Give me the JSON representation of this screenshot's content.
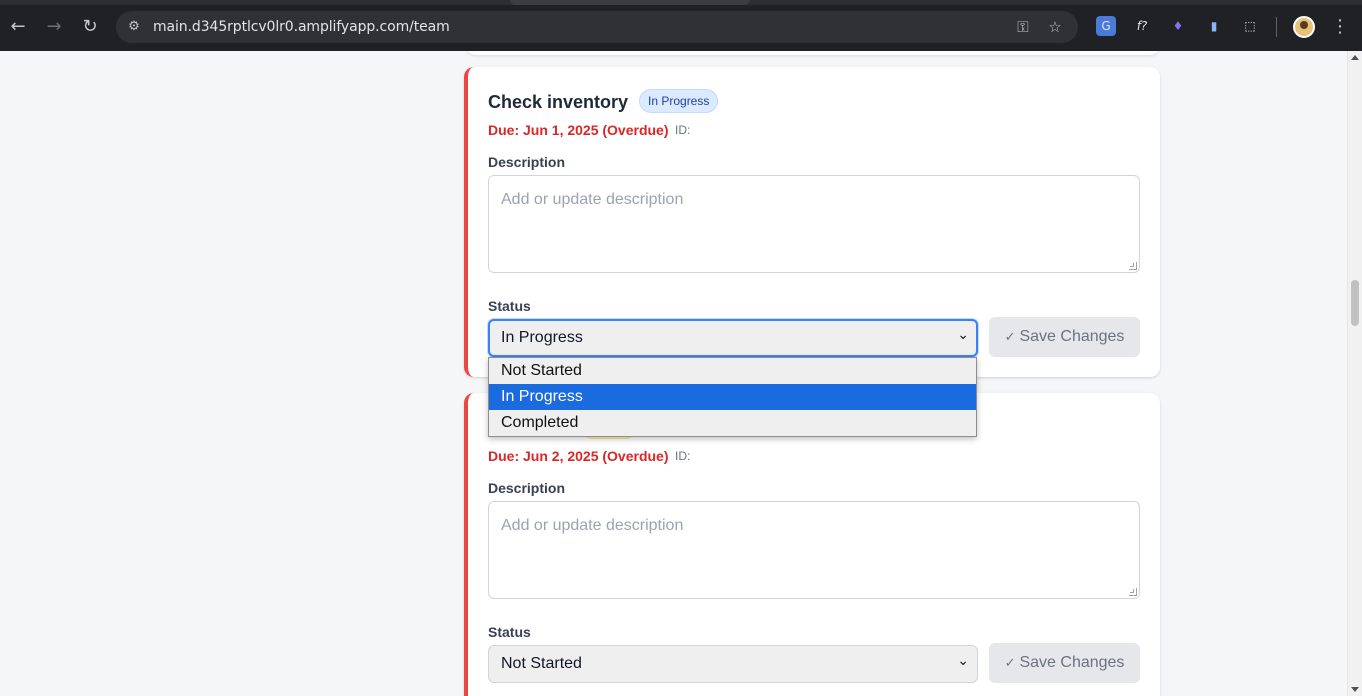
{
  "browser": {
    "url": "main.d345rptlcv0lr0.amplifyapp.com/team",
    "back_icon": "arrow-left-icon",
    "forward_icon": "arrow-right-icon",
    "reload_icon": "reload-icon",
    "extensions": [
      "google-translate-icon",
      "formula-icon",
      "flame-icon",
      "clipboard-icon",
      "puzzle-icon"
    ]
  },
  "tasks": [
    {
      "title": "Check inventory",
      "status_badge": "In Progress",
      "due": "Due: Jun 1, 2025 (Overdue)",
      "id_label": "ID:",
      "description_label": "Description",
      "description_placeholder": "Add or update description",
      "status_label": "Status",
      "status_value": "In Progress",
      "save_label": "Save Changes"
    },
    {
      "title": "",
      "status_badge": "",
      "due": "Due: Jun 2, 2025 (Overdue)",
      "id_label": "ID:",
      "description_label": "Description",
      "description_placeholder": "Add or update description",
      "status_label": "Status",
      "status_value": "Not Started",
      "save_label": "Save Changes"
    }
  ],
  "dropdown": {
    "options": [
      "Not Started",
      "In Progress",
      "Completed"
    ],
    "selected": "In Progress"
  },
  "colors": {
    "overdue_accent": "#ef4444",
    "due_text": "#dc2626",
    "badge_in_progress_bg": "#dbeafe",
    "dropdown_highlight": "#1a6ae0"
  }
}
